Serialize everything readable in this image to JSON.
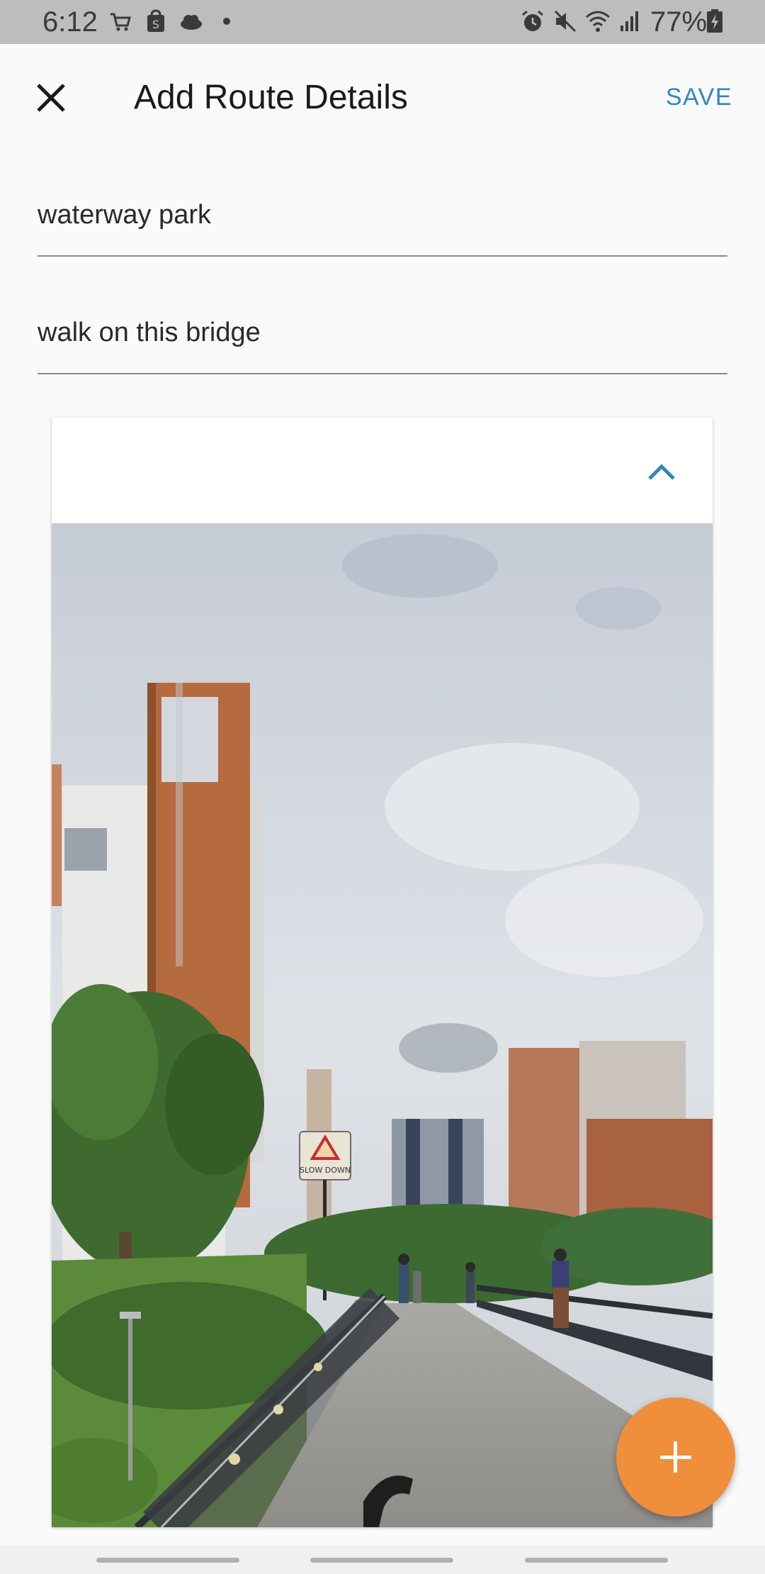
{
  "status_bar": {
    "time": "6:12",
    "battery": "77%",
    "left_icons": [
      "cart-icon",
      "shopping-bag-icon",
      "cloud-icon",
      "dot-icon"
    ],
    "right_icons": [
      "alarm-icon",
      "mute-icon",
      "wifi-icon",
      "signal-icon",
      "battery-charging-icon"
    ]
  },
  "app_bar": {
    "title": "Add Route Details",
    "save_label": "SAVE",
    "close_icon": "close-icon"
  },
  "form": {
    "name_value": "waterway park",
    "description_value": "walk on this bridge"
  },
  "card": {
    "collapse_icon": "chevron-up-icon",
    "photo_sign_text": "SLOW DOWN"
  },
  "fab": {
    "icon": "plus-icon"
  },
  "colors": {
    "accent": "#2e86c1",
    "fab": "#ef8e3b",
    "status_bar": "#bdbdbd",
    "background": "#fafafa"
  }
}
